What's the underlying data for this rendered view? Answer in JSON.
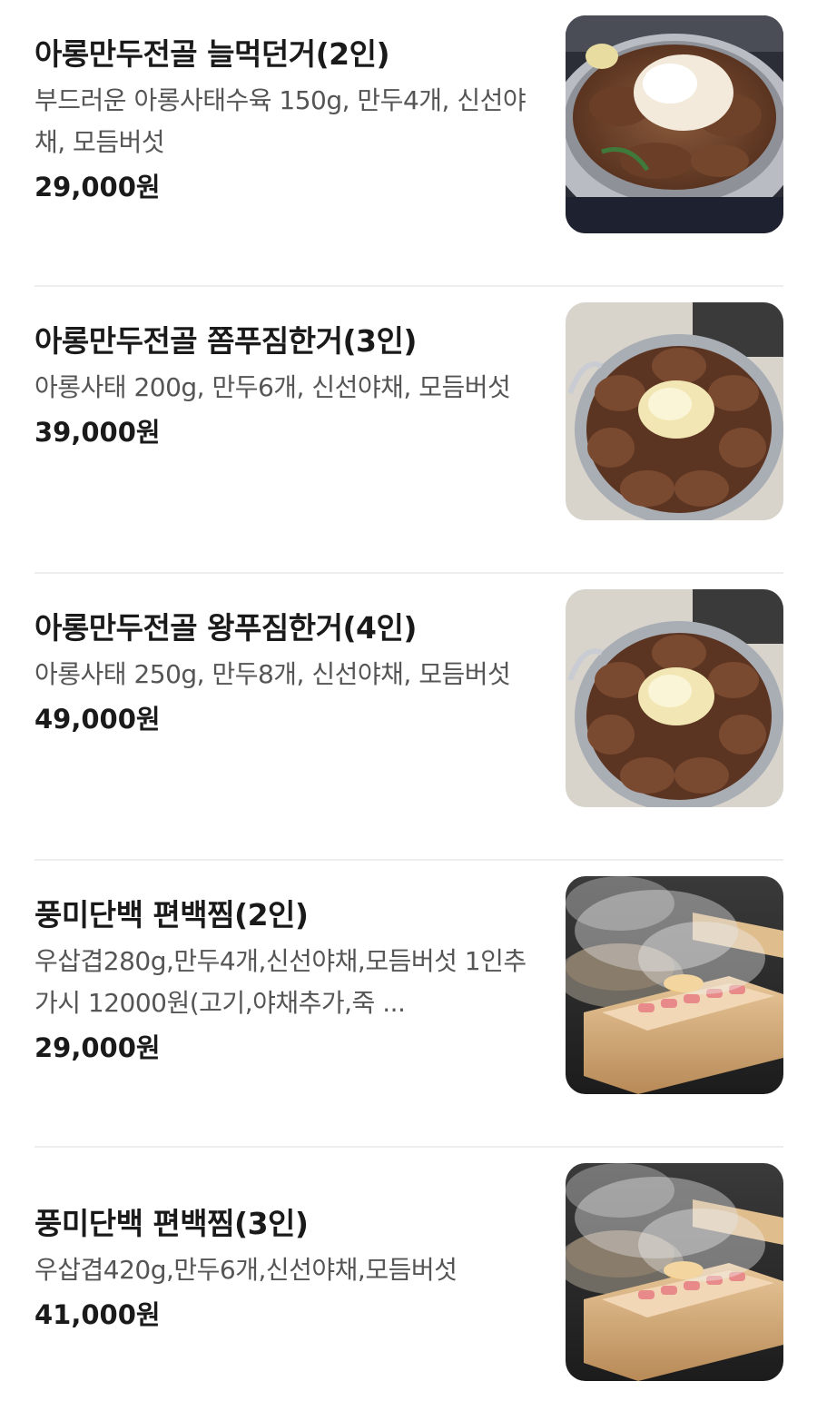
{
  "menu": {
    "items": [
      {
        "name": "아롱만두전골 늘먹던거(2인)",
        "description": "부드러운 아롱사태수육 150g, 만두4개, 신선야채, 모듬버섯",
        "price": "29,000원",
        "image": "beef-hotpot-photo"
      },
      {
        "name": "아롱만두전골 쫌푸짐한거(3인)",
        "description": "아롱사태 200g, 만두6개, 신선야채, 모듬버섯",
        "price": "39,000원",
        "image": "beef-hotpot-photo"
      },
      {
        "name": "아롱만두전골 왕푸짐한거(4인)",
        "description": "아롱사태 250g, 만두8개, 신선야채, 모듬버섯",
        "price": "49,000원",
        "image": "beef-hotpot-photo"
      },
      {
        "name": "풍미단백 편백찜(2인)",
        "description": "우삽겹280g,만두4개,신선야채,모듬버섯 1인추가시 12000원(고기,야채추가,죽 ...",
        "price": "29,000원",
        "image": "cypress-steamer-photo"
      },
      {
        "name": "풍미단백 편백찜(3인)",
        "description": "우삽겹420g,만두6개,신선야채,모듬버섯",
        "price": "41,000원",
        "image": "cypress-steamer-photo"
      }
    ]
  },
  "colors": {
    "text_primary": "#1a1a1a",
    "text_secondary": "#555555",
    "divider": "#eeeeee"
  }
}
